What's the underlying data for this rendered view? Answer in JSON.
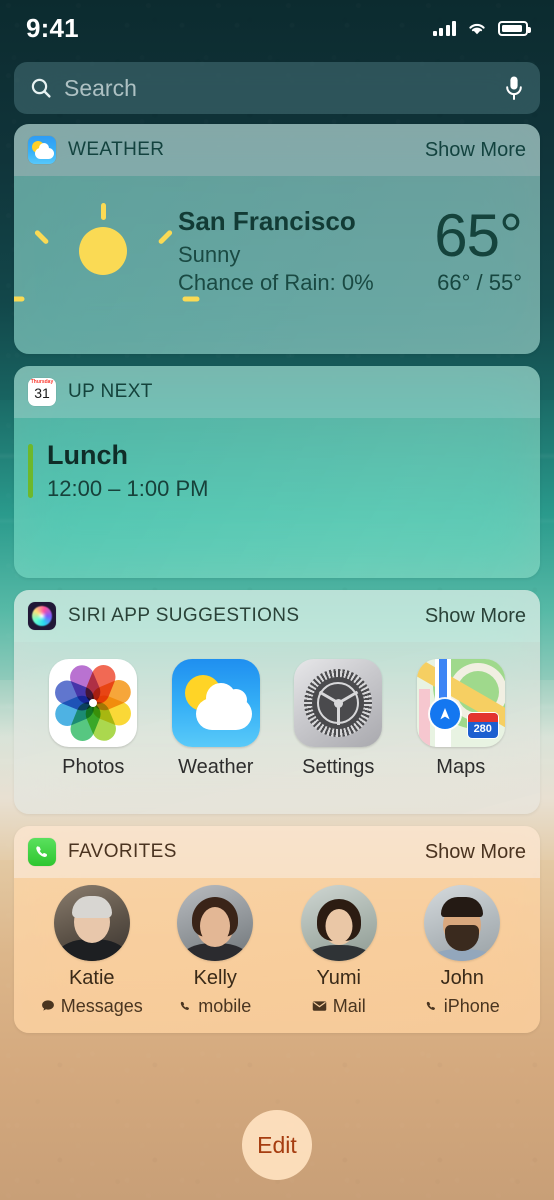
{
  "status_bar": {
    "time": "9:41",
    "cellular_icon": "cellular-bars-icon",
    "wifi_icon": "wifi-icon",
    "battery_icon": "battery-icon"
  },
  "search": {
    "placeholder": "Search",
    "icon": "search-icon",
    "mic_icon": "microphone-icon"
  },
  "widgets": {
    "weather": {
      "app_icon": "weather-app-icon",
      "title": "WEATHER",
      "show_more": "Show More",
      "condition_icon": "sun-icon",
      "city": "San Francisco",
      "condition": "Sunny",
      "rain": "Chance of Rain: 0%",
      "temperature": "65°",
      "high_low": "66° / 55°"
    },
    "up_next": {
      "app_icon": "calendar-app-icon",
      "calendar_day_of_week": "Thursday",
      "calendar_date": "31",
      "title": "UP NEXT",
      "event_title": "Lunch",
      "event_time": "12:00 – 1:00 PM",
      "accent_color": "#6eb82a"
    },
    "siri_suggestions": {
      "app_icon": "siri-app-icon",
      "title": "SIRI APP SUGGESTIONS",
      "show_more": "Show More",
      "apps": [
        {
          "label": "Photos",
          "icon": "photos-app-icon"
        },
        {
          "label": "Weather",
          "icon": "weather-app-icon"
        },
        {
          "label": "Settings",
          "icon": "settings-app-icon"
        },
        {
          "label": "Maps",
          "icon": "maps-app-icon",
          "highway_badge": "280"
        }
      ]
    },
    "favorites": {
      "app_icon": "phone-app-icon",
      "title": "FAVORITES",
      "show_more": "Show More",
      "contacts": [
        {
          "name": "Katie",
          "action": "Messages",
          "action_icon": "message-bubble-icon"
        },
        {
          "name": "Kelly",
          "action": "mobile",
          "action_icon": "phone-handset-icon"
        },
        {
          "name": "Yumi",
          "action": "Mail",
          "action_icon": "envelope-icon"
        },
        {
          "name": "John",
          "action": "iPhone",
          "action_icon": "phone-handset-icon"
        }
      ]
    }
  },
  "edit_button": {
    "label": "Edit"
  },
  "colors": {
    "accent_event": "#6eb82a",
    "edit_text": "#a63d10",
    "weather_text": "#15433c",
    "favorites_text": "#4a3520"
  }
}
